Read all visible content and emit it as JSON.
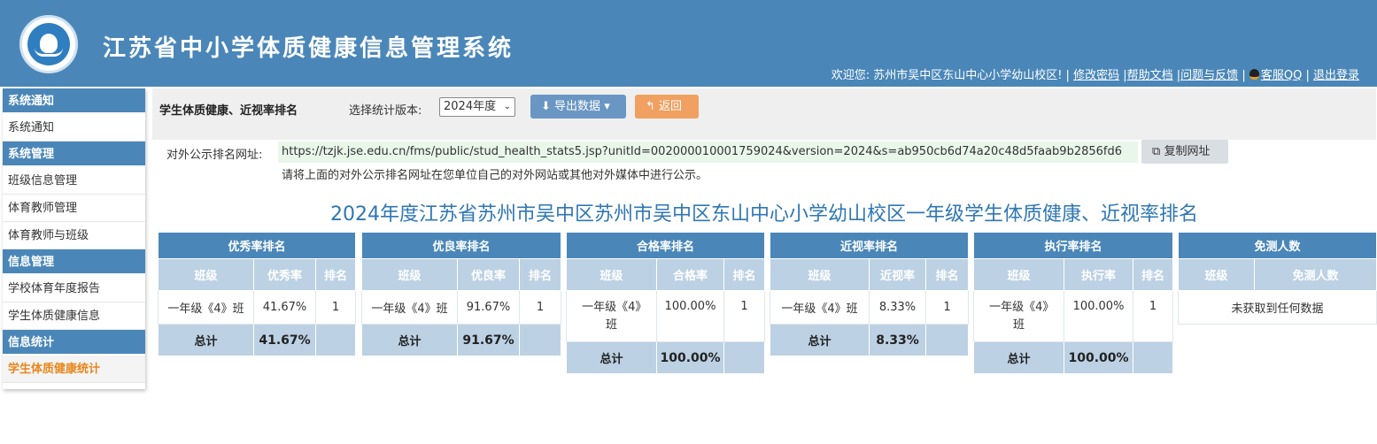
{
  "header": {
    "app_title": "江苏省中小学体质健康信息管理系统",
    "welcome": "欢迎您: 苏州市吴中区东山中心小学幼山校区! |",
    "links": [
      "修改密码",
      "|帮助文档",
      "|问题与反馈",
      "|",
      "客服QQ",
      "|",
      "退出登录"
    ]
  },
  "sidebar": {
    "groups": [
      {
        "title": "系统通知",
        "items": [
          "系统通知"
        ]
      },
      {
        "title": "系统管理",
        "items": [
          "班级信息管理",
          "体育教师管理",
          "体育教师与班级"
        ]
      },
      {
        "title": "信息管理",
        "items": [
          "学校体育年度报告",
          "学生体质健康信息"
        ]
      },
      {
        "title": "信息统计",
        "items": [
          "学生体质健康统计"
        ]
      }
    ],
    "active_item": "学生体质健康统计"
  },
  "toolbar": {
    "title": "学生体质健康、近视率排名",
    "version_label": "选择统计版本:",
    "version_value": "2024年度",
    "export_label": "导出数据",
    "back_label": "返回"
  },
  "public_url": {
    "label": "对外公示排名网址:",
    "value": "https://tzjk.jse.edu.cn/fms/public/stud_health_stats5.jsp?unitId=002000010001759024&version=2024&s=ab950cb6d74a20c48d5faab9b2856fd6",
    "copy_label": "复制网址",
    "hint": "请将上面的对外公示排名网址在您单位自己的对外网站或其他对外媒体中进行公示。"
  },
  "report_title": "2024年度江苏省苏州市吴中区苏州市吴中区东山中心小学幼山校区一年级学生体质健康、近视率排名",
  "tables": [
    {
      "caption": "优秀率排名",
      "cols": [
        "班级",
        "优秀率",
        "排名"
      ],
      "row": [
        "一年级《4》班",
        "41.67%",
        "1"
      ],
      "total": [
        "总计",
        "41.67%",
        ""
      ]
    },
    {
      "caption": "优良率排名",
      "cols": [
        "班级",
        "优良率",
        "排名"
      ],
      "row": [
        "一年级《4》班",
        "91.67%",
        "1"
      ],
      "total": [
        "总计",
        "91.67%",
        ""
      ]
    },
    {
      "caption": "合格率排名",
      "cols": [
        "班级",
        "合格率",
        "排名"
      ],
      "row": [
        "一年级《4》班",
        "100.00%",
        "1"
      ],
      "total": [
        "总计",
        "100.00%",
        ""
      ]
    },
    {
      "caption": "近视率排名",
      "cols": [
        "班级",
        "近视率",
        "排名"
      ],
      "row": [
        "一年级《4》班",
        "8.33%",
        "1"
      ],
      "total": [
        "总计",
        "8.33%",
        ""
      ]
    },
    {
      "caption": "执行率排名",
      "cols": [
        "班级",
        "执行率",
        "排名"
      ],
      "row": [
        "一年级《4》班",
        "100.00%",
        "1"
      ],
      "total": [
        "总计",
        "100.00%",
        ""
      ]
    },
    {
      "caption": "免测人数",
      "cols": [
        "班级",
        "免测人数"
      ],
      "empty_text": "未获取到任何数据"
    }
  ],
  "colors": {
    "brand": "#4a87b8",
    "accent": "#e8861a",
    "header_cell": "#bcd1e3",
    "title_text": "#2f77b4"
  }
}
